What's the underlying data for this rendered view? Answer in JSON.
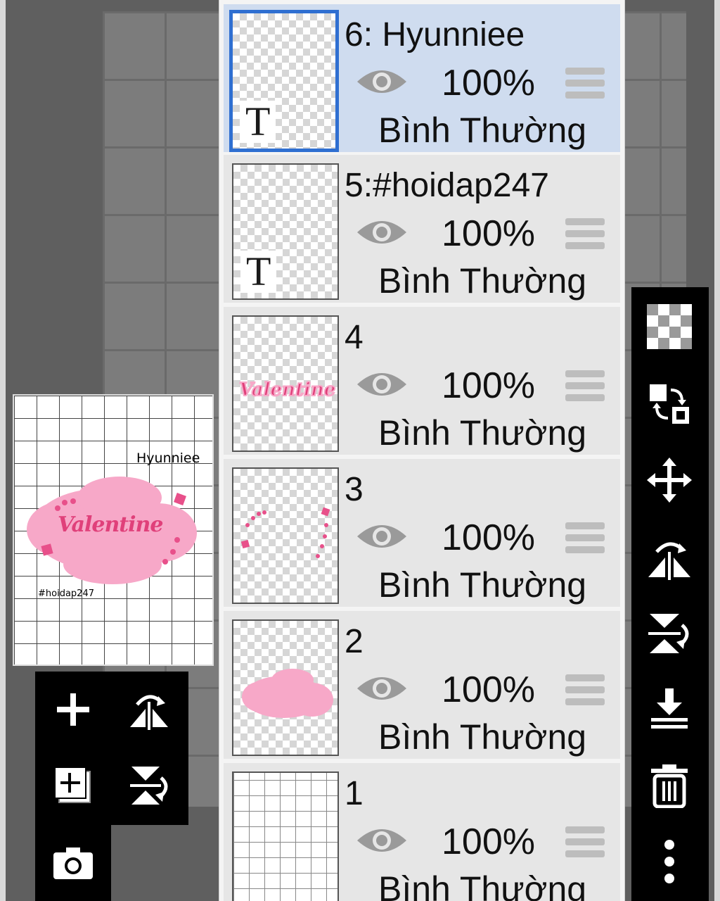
{
  "layers": [
    {
      "name": "6: Hyunniee",
      "opacity": "100%",
      "blend": "Bình Thường",
      "selected": true,
      "thumb": "text"
    },
    {
      "name": "5:#hoidap247",
      "opacity": "100%",
      "blend": "Bình Thường",
      "selected": false,
      "thumb": "text"
    },
    {
      "name": "4",
      "opacity": "100%",
      "blend": "Bình Thường",
      "selected": false,
      "thumb": "valentine"
    },
    {
      "name": "3",
      "opacity": "100%",
      "blend": "Bình Thường",
      "selected": false,
      "thumb": "dots"
    },
    {
      "name": "2",
      "opacity": "100%",
      "blend": "Bình Thường",
      "selected": false,
      "thumb": "cloud"
    },
    {
      "name": "1",
      "opacity": "100%",
      "blend": "Bình Thường",
      "selected": false,
      "thumb": "grid"
    }
  ],
  "text_thumb_glyph": "T",
  "preview": {
    "hyunniee": "Hyunniee",
    "valentine": "Valentine",
    "tag": "#hoidap247"
  },
  "colors": {
    "selected_row": "#cfdcef",
    "selected_border": "#2f6fd1",
    "pink": "#f7a8c8",
    "pink_text": "#e0407a"
  }
}
